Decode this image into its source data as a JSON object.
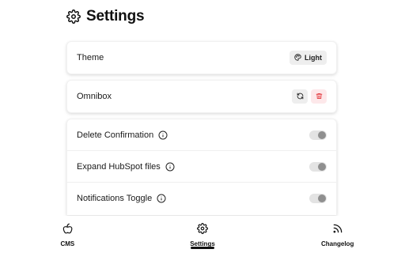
{
  "header": {
    "title": "Settings",
    "icon": "gear-icon"
  },
  "theme": {
    "label": "Theme",
    "button_label": "Light",
    "button_icon": "palette-icon"
  },
  "omnibox": {
    "label": "Omnibox",
    "refresh_icon": "refresh-icon",
    "delete_icon": "trash-icon"
  },
  "toggles": [
    {
      "label": "Delete Confirmation",
      "enabled": true
    },
    {
      "label": "Expand HubSpot files",
      "enabled": true
    },
    {
      "label": "Notifications Toggle",
      "enabled": true
    }
  ],
  "nav": {
    "items": [
      {
        "label": "CMS",
        "icon": "apple-icon",
        "active": false
      },
      {
        "label": "Settings",
        "icon": "gear-icon",
        "active": true
      },
      {
        "label": "Changelog",
        "icon": "rss-icon",
        "active": false
      }
    ]
  },
  "colors": {
    "delete_accent": "#e5484d",
    "delete_bg": "#fde8ea",
    "button_bg": "#eeeeee",
    "toggle_knob": "#8f8f8f"
  }
}
